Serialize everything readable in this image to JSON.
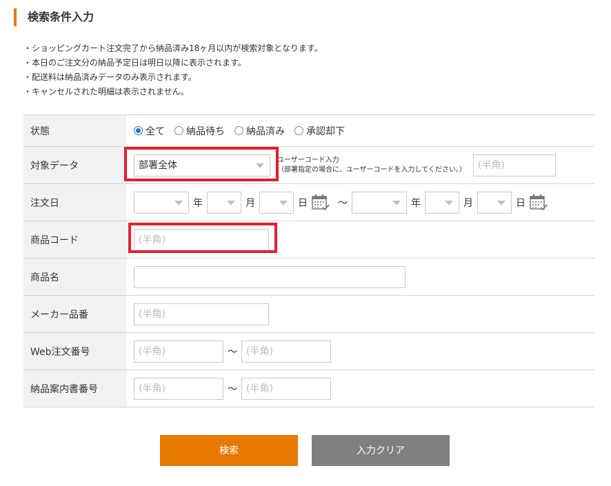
{
  "section": {
    "title": "検索条件入力"
  },
  "notes": [
    "・ショッピングカート注文完了から納品済み18ヶ月以内が検索対象となります。",
    "・本日のご注文分の納品予定日は明日以降に表示されます。",
    "・配送料は納品済みデータのみ表示されます。",
    "・キャンセルされた明細は表示されません。"
  ],
  "form": {
    "status": {
      "label": "状態",
      "options": [
        "全て",
        "納品待ち",
        "納品済み",
        "承認却下"
      ],
      "selected": "全て"
    },
    "target": {
      "label": "対象データ",
      "selected": "部署全体",
      "hint_line1": "ユーザーコード入力",
      "hint_line2": "（部署指定の場合に、ユーザーコードを入力してください。）",
      "user_code_placeholder": "(半角)"
    },
    "order_date": {
      "label": "注文日",
      "year_unit": "年",
      "month_unit": "月",
      "day_unit": "日",
      "range_sep": "～"
    },
    "product_code": {
      "label": "商品コード",
      "placeholder": "(半角)"
    },
    "product_name": {
      "label": "商品名",
      "placeholder": ""
    },
    "maker_part_no": {
      "label": "メーカー品番",
      "placeholder": "(半角)"
    },
    "web_order_no": {
      "label": "Web注文番号",
      "placeholder": "(半角)",
      "range_sep": "～"
    },
    "delivery_note_no": {
      "label": "納品案内書番号",
      "placeholder": "(半角)",
      "range_sep": "～"
    }
  },
  "buttons": {
    "search": "検索",
    "clear": "入力クリア"
  },
  "colors": {
    "accent": "#e77800",
    "highlight": "#e02030",
    "clear_button": "#7f7f7f",
    "radio_checked": "#1a73e8"
  },
  "icons": {
    "calendar": "calendar-icon",
    "dropdown": "chevron-down-icon"
  }
}
